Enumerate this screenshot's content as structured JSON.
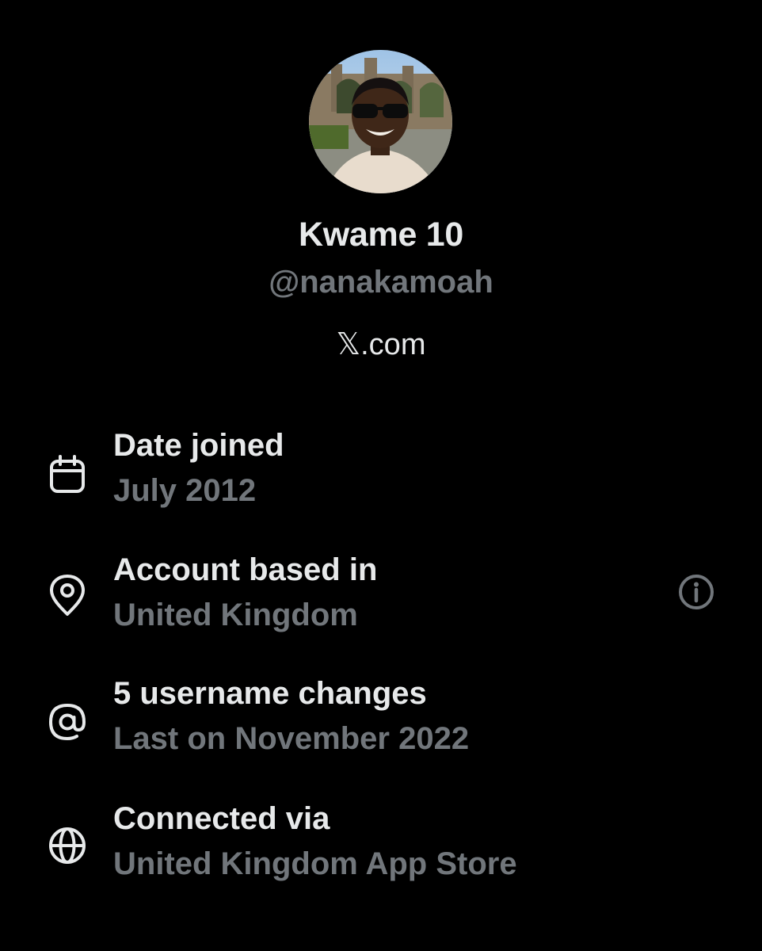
{
  "profile": {
    "display_name": "Kwame 10",
    "handle": "@nanakamoah",
    "site_prefix": "𝕏",
    "site_suffix": ".com"
  },
  "details": {
    "date_joined": {
      "title": "Date joined",
      "value": "July 2012",
      "icon": "calendar-icon"
    },
    "account_based_in": {
      "title": "Account based in",
      "value": "United Kingdom",
      "icon": "location-pin-icon",
      "action_icon": "info-icon"
    },
    "username_changes": {
      "title": "5 username changes",
      "value": "Last on November 2022",
      "icon": "at-sign-icon"
    },
    "connected_via": {
      "title": "Connected via",
      "value": "United Kingdom App Store",
      "icon": "globe-icon"
    }
  },
  "colors": {
    "background": "#000000",
    "primary_text": "#e7e9ea",
    "secondary_text": "#71767b"
  }
}
